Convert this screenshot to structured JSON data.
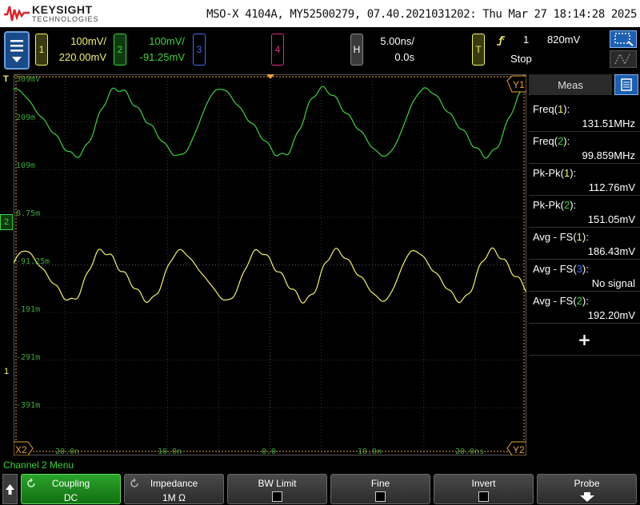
{
  "title_bar": {
    "brand": "KEYSIGHT",
    "brand_sub": "TECHNOLOGIES",
    "instrument_info": "MSO-X 4104A, MY52500279, 07.40.2021031202: Thu Mar 27 18:14:28 2025"
  },
  "channels": [
    {
      "num": "1",
      "scale": "100mV/",
      "offset": "220.00mV",
      "color": "#f2f26e"
    },
    {
      "num": "2",
      "scale": "100mV/",
      "offset": "-91.25mV",
      "color": "#3fd23f"
    },
    {
      "num": "3",
      "color": "#4a6cf0"
    },
    {
      "num": "4",
      "color": "#e0308a"
    }
  ],
  "horizontal": {
    "key": "H",
    "scale": "5.00ns/",
    "delay": "0.0s"
  },
  "trigger": {
    "key": "T",
    "source": "1",
    "level": "820mV",
    "mode": "Stop"
  },
  "graticule": {
    "ch2_level_labels": [
      "309mV",
      "209m",
      "109m",
      "8.75m",
      "-91.25m",
      "-191m",
      "-291m",
      "-391m"
    ],
    "time_labels": [
      "-20.0n",
      "-10.0n",
      "0.0",
      "10.0n",
      "20.0ns"
    ],
    "markers": {
      "y1": "Y1",
      "y2": "Y2",
      "x2": "X2",
      "ch2": "2",
      "ch1": "1",
      "trig": "T"
    }
  },
  "measurements": {
    "tab": "Meas",
    "items": [
      {
        "name": "Freq(",
        "ch": "1",
        "value": "131.51MHz"
      },
      {
        "name": "Freq(",
        "ch": "2",
        "value": "99.859MHz"
      },
      {
        "name": "Pk-Pk(",
        "ch": "1",
        "value": "112.76mV"
      },
      {
        "name": "Pk-Pk(",
        "ch": "2",
        "value": "151.05mV"
      },
      {
        "name": "Avg - FS(",
        "ch": "1",
        "value": "186.43mV"
      },
      {
        "name": "Avg - FS(",
        "ch": "3",
        "value": "No signal"
      },
      {
        "name": "Avg - FS(",
        "ch": "2",
        "value": "192.20mV"
      }
    ],
    "add": "+"
  },
  "softkeys": {
    "menu_title": "Channel 2 Menu",
    "coupling": {
      "label": "Coupling",
      "value": "DC"
    },
    "impedance": {
      "label": "Impedance",
      "value": "1M Ω"
    },
    "bw_limit": {
      "label": "BW Limit"
    },
    "fine": {
      "label": "Fine"
    },
    "invert": {
      "label": "Invert"
    },
    "probe": {
      "label": "Probe"
    }
  }
}
